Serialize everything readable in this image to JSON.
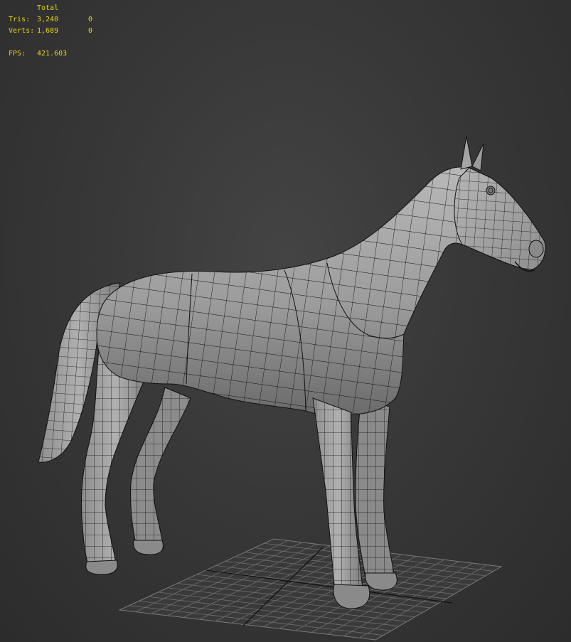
{
  "viewport": {
    "background_color": "#3a3a3a",
    "stats_color": "#e6d21a",
    "mesh_fill": "#9a9a9a",
    "wire_color": "#0d0d0d"
  },
  "stats": {
    "header": "Total",
    "tris_label": "Tris:",
    "tris_total": "3,240",
    "tris_selected": "0",
    "verts_label": "Verts:",
    "verts_total": "1,689",
    "verts_selected": "0",
    "fps_label": "FPS:",
    "fps_value": "421.603"
  },
  "scene": {
    "object": "horse-mesh",
    "display_mode": "shaded-wireframe",
    "grid": "home-grid"
  }
}
